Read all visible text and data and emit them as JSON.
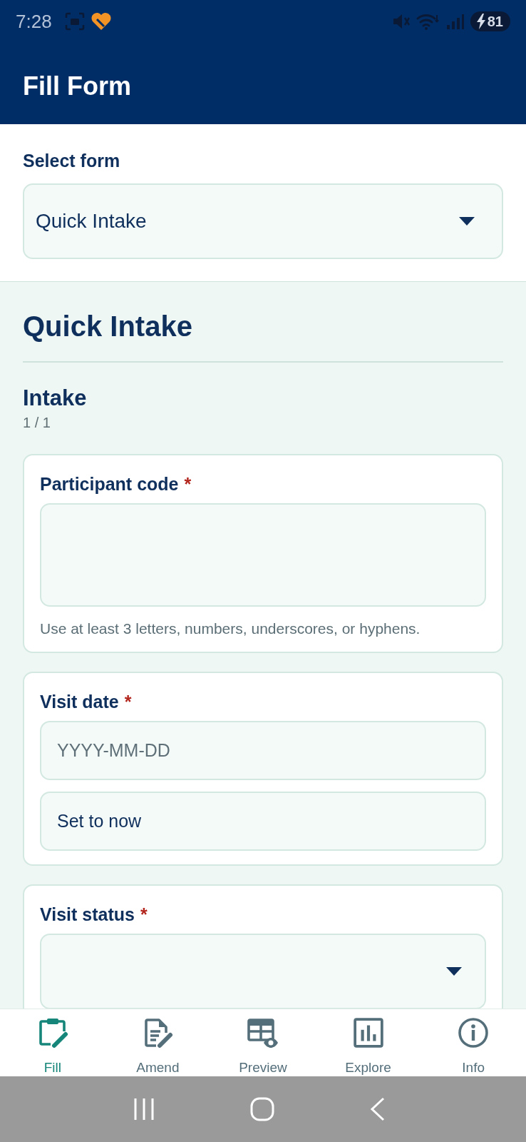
{
  "status_bar": {
    "time": "7:28",
    "charging": true,
    "battery": "81"
  },
  "app_bar": {
    "title": "Fill Form"
  },
  "form_selector": {
    "label": "Select form",
    "value": "Quick Intake"
  },
  "form": {
    "title": "Quick Intake",
    "required_mark": "*",
    "section": {
      "title": "Intake",
      "page": "1 / 1"
    },
    "fields": [
      {
        "kind": "textarea",
        "label": "Participant code",
        "required": true,
        "hint": "Use at least 3 letters, numbers, underscores, or hyphens."
      },
      {
        "kind": "date",
        "label": "Visit date",
        "required": true,
        "placeholder": "YYYY-MM-DD",
        "button": "Set to now"
      },
      {
        "kind": "select",
        "label": "Visit status",
        "required": true
      }
    ]
  },
  "bottom_nav": [
    {
      "label": "Fill",
      "selected": true
    },
    {
      "label": "Amend",
      "selected": false
    },
    {
      "label": "Preview",
      "selected": false
    },
    {
      "label": "Explore",
      "selected": false
    },
    {
      "label": "Info",
      "selected": false
    }
  ]
}
